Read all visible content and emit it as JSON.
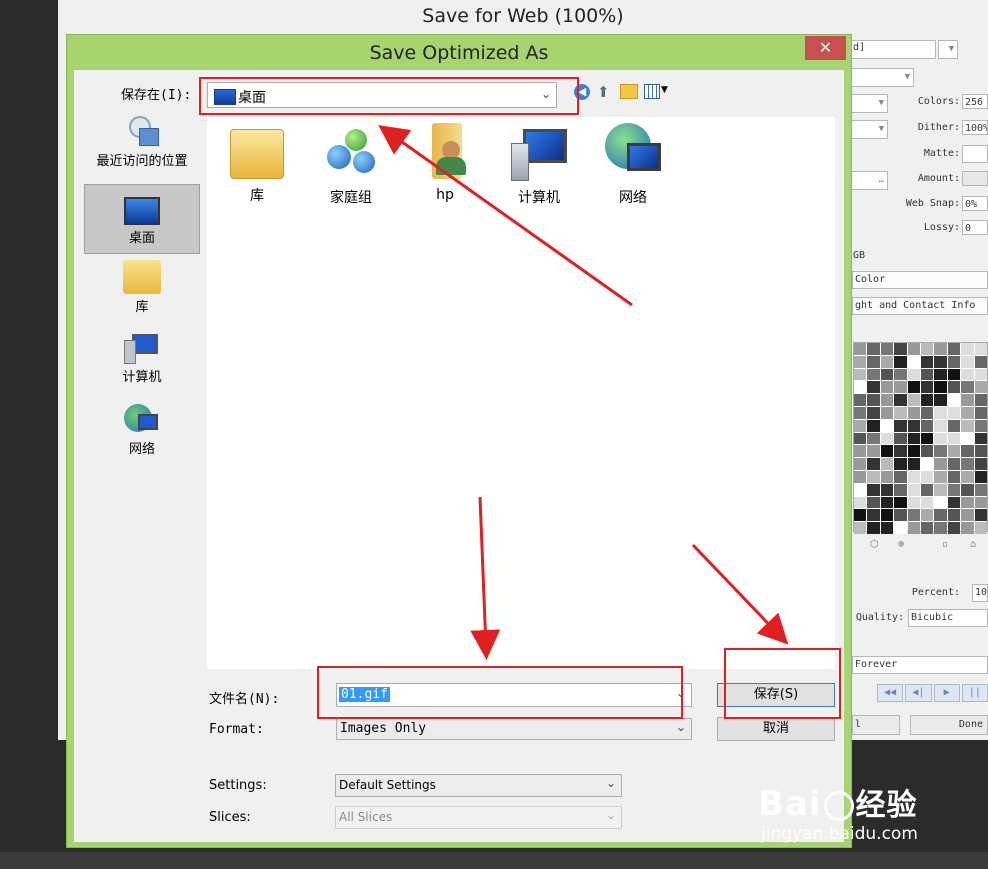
{
  "background_window": {
    "title": "Save for Web (100%)",
    "panel": {
      "top_combo_value": "d]",
      "colors_label": "Colors:",
      "colors_value": "256",
      "dither_label": "Dither:",
      "dither_value": "100%",
      "matte_label": "Matte:",
      "amount_label": "Amount:",
      "websnap_label": "Web Snap:",
      "websnap_value": "0%",
      "lossy_label": "Lossy:",
      "lossy_value": "0",
      "rgb_text": "GB",
      "color_text": "Color",
      "contact_text": "ght and Contact Info",
      "percent_label": "Percent:",
      "percent_value": "10",
      "quality_label": "Quality:",
      "quality_value": "Bicubic",
      "loop_value": "Forever",
      "done_label": "Done",
      "small_btn_label": "l",
      "play_buttons": [
        "◀◀",
        "◀|",
        "▶",
        "||"
      ]
    }
  },
  "dialog": {
    "title": "Save Optimized As",
    "close_symbol": "✕",
    "save_in_label": "保存在(I):",
    "save_in_value": "桌面",
    "places": [
      {
        "label": "最近访问的位置",
        "icon": "recent-places-icon"
      },
      {
        "label": "桌面",
        "icon": "desktop-icon"
      },
      {
        "label": "库",
        "icon": "library-icon"
      },
      {
        "label": "计算机",
        "icon": "computer-icon"
      },
      {
        "label": "网络",
        "icon": "network-icon"
      }
    ],
    "files": [
      {
        "label": "库",
        "icon": "library-folder-icon"
      },
      {
        "label": "家庭组",
        "icon": "homegroup-icon"
      },
      {
        "label": "hp",
        "icon": "user-folder-icon"
      },
      {
        "label": "计算机",
        "icon": "computer-icon"
      },
      {
        "label": "网络",
        "icon": "network-icon"
      }
    ],
    "filename_label": "文件名(N):",
    "filename_value": "01.gif",
    "format_label": "Format:",
    "format_value": "Images Only",
    "save_button": "保存(S)",
    "cancel_button": "取消",
    "settings_label": "Settings:",
    "settings_value": "Default Settings",
    "slices_label": "Slices:",
    "slices_value": "All Slices"
  },
  "watermark": {
    "brand": "Bai",
    "brand_cn": "经验",
    "url": "jingyan.baidu.com"
  },
  "colors": {
    "dialog_frame": "#a8d470",
    "annotation_red": "#e02020",
    "selection_blue": "#3399ff"
  }
}
